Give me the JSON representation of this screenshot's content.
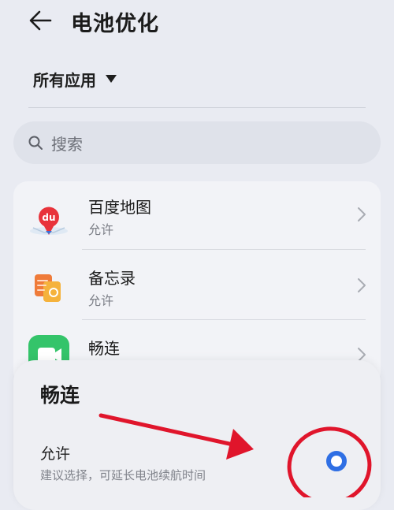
{
  "header": {
    "title": "电池优化",
    "back_icon": "arrow-left-icon"
  },
  "filter": {
    "label": "所有应用",
    "caret_icon": "caret-down-icon"
  },
  "search": {
    "placeholder": "搜索",
    "icon": "search-icon"
  },
  "apps": [
    {
      "name": "百度地图",
      "status": "允许",
      "icon": "baidu-maps-icon"
    },
    {
      "name": "备忘录",
      "status": "允许",
      "icon": "notes-icon"
    },
    {
      "name": "畅连",
      "status": "",
      "icon": "meetime-icon"
    }
  ],
  "sheet": {
    "title": "畅连",
    "option": {
      "label": "允许",
      "description": "建议选择，可延长电池续航时间",
      "selected": true
    }
  },
  "colors": {
    "background": "#e9ebf2",
    "accent": "#2f6fe4",
    "annotation": "#e0152b"
  }
}
